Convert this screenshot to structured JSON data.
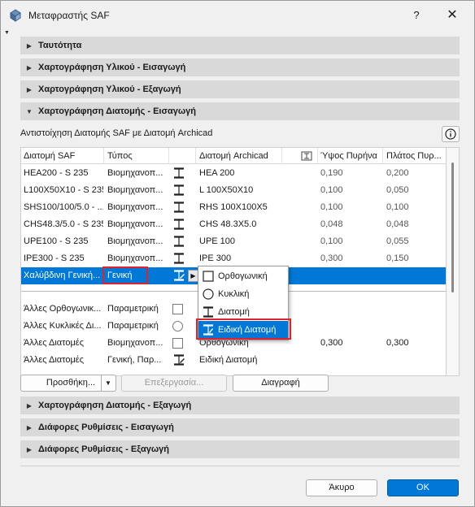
{
  "window": {
    "title": "Μεταφραστής SAF",
    "help_label": "?",
    "close_label": "✕"
  },
  "sections_top": [
    {
      "label": "Ταυτότητα",
      "expanded": false
    },
    {
      "label": "Χαρτογράφηση Υλικού - Εισαγωγή",
      "expanded": false
    },
    {
      "label": "Χαρτογράφηση Υλικού - Εξαγωγή",
      "expanded": false
    },
    {
      "label": "Χαρτογράφηση Διατομής - Εισαγωγή",
      "expanded": true
    }
  ],
  "subtitle": "Αντιστοίχηση Διατομής SAF με Διατομή Archicad",
  "info_icon": "info-icon",
  "table": {
    "columns": [
      "Διατομή SAF",
      "Τύπος",
      "Διατομή Archicad",
      "Ύψος Πυρήνα",
      "Πλάτος Πυρ..."
    ],
    "rows": [
      {
        "saf": "HEA200 - S 235",
        "type": "Βιομηχανοπ...",
        "archicad": "HEA 200",
        "h": "0,190",
        "w": "0,200"
      },
      {
        "saf": "L100X50X10 - S 235",
        "type": "Βιομηχανοπ...",
        "archicad": "L 100X50X10",
        "h": "0,100",
        "w": "0,050"
      },
      {
        "saf": "SHS100/100/5.0 - ...",
        "type": "Βιομηχανοπ...",
        "archicad": "RHS 100X100X5",
        "h": "0,100",
        "w": "0,100"
      },
      {
        "saf": "CHS48.3/5.0 - S 235",
        "type": "Βιομηχανοπ...",
        "archicad": "CHS 48.3X5.0",
        "h": "0,048",
        "w": "0,048"
      },
      {
        "saf": "UPE100 - S 235",
        "type": "Βιομηχανοπ...",
        "archicad": "UPE 100",
        "h": "0,100",
        "w": "0,055"
      },
      {
        "saf": "IPE300 - S 235",
        "type": "Βιομηχανοπ...",
        "archicad": "IPE 300",
        "h": "0,300",
        "w": "0,150"
      }
    ],
    "selected_row": {
      "saf": "Χαλύβδινη Γενική...",
      "type": "Γενική"
    },
    "default_rows": [
      {
        "saf": "Άλλες Ορθογωνικ...",
        "type": "Παραμετρική",
        "archicad": "",
        "h": "",
        "w": ""
      },
      {
        "saf": "Άλλες Κυκλικές Δι...",
        "type": "Παραμετρική",
        "archicad": "",
        "h": "",
        "w": ""
      },
      {
        "saf": "Άλλες Διατομές",
        "type": "Βιομηχανοπ...",
        "archicad": "Ορθογώνική",
        "h": "0,300",
        "w": "0,300"
      },
      {
        "saf": "Άλλες Διατομές",
        "type": "Γενική, Παρ...",
        "archicad": "Ειδική Διατομή",
        "h": "",
        "w": ""
      }
    ]
  },
  "popup": {
    "items": [
      {
        "label": "Ορθογωνική",
        "icon": "square-icon"
      },
      {
        "label": "Κυκλική",
        "icon": "circle-icon"
      },
      {
        "label": "Διατομή",
        "icon": "i-beam-icon"
      },
      {
        "label": "Ειδική Διατομή",
        "icon": "special-profile-icon",
        "active": true
      }
    ]
  },
  "buttons": {
    "add": "Προσθήκη...",
    "edit": "Επεξεργασία...",
    "delete": "Διαγραφή",
    "cancel": "Άκυρο",
    "ok": "ΟΚ"
  },
  "sections_bottom": [
    {
      "label": "Χαρτογράφηση Διατομής - Εξαγωγή"
    },
    {
      "label": "Διάφορες Ρυθμίσεις - Εισαγωγή"
    },
    {
      "label": "Διάφορες Ρυθμίσεις - Εξαγωγή"
    }
  ],
  "colors": {
    "selection": "#0078d7",
    "highlight_box": "#e0222d",
    "section_bg": "#d9d9d9"
  }
}
